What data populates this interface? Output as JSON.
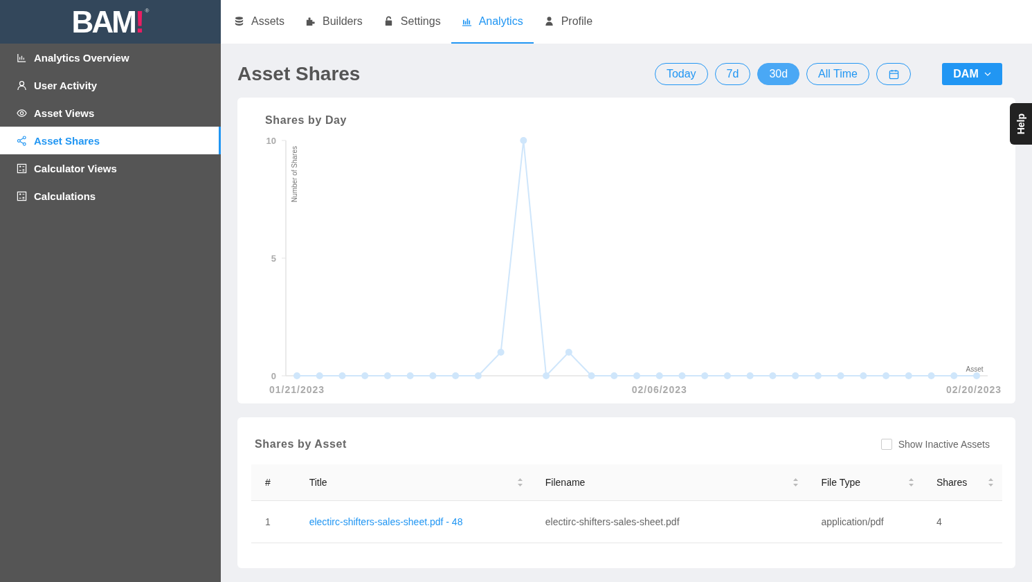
{
  "logo": {
    "text": "BAM",
    "mark": "!",
    "registered": "®"
  },
  "sidebar": {
    "items": [
      {
        "label": "Analytics Overview",
        "selected": false
      },
      {
        "label": "User Activity",
        "selected": false
      },
      {
        "label": "Asset Views",
        "selected": false
      },
      {
        "label": "Asset Shares",
        "selected": true
      },
      {
        "label": "Calculator Views",
        "selected": false
      },
      {
        "label": "Calculations",
        "selected": false
      }
    ]
  },
  "tabs": [
    {
      "label": "Assets",
      "selected": false
    },
    {
      "label": "Builders",
      "selected": false
    },
    {
      "label": "Settings",
      "selected": false
    },
    {
      "label": "Analytics",
      "selected": true
    },
    {
      "label": "Profile",
      "selected": false
    }
  ],
  "page_title": "Asset Shares",
  "ranges": [
    {
      "label": "Today",
      "kind": "text",
      "selected": false
    },
    {
      "label": "7d",
      "kind": "text",
      "selected": false
    },
    {
      "label": "30d",
      "kind": "text",
      "selected": true
    },
    {
      "label": "All Time",
      "kind": "text",
      "selected": false
    },
    {
      "kind": "calendar",
      "selected": false
    }
  ],
  "source_menu": {
    "label": "DAM"
  },
  "help_tab": "Help",
  "chart_card": {
    "title": "Shares by Day",
    "chart_data": {
      "type": "line",
      "ylabel": "Number of Shares",
      "categories": [
        "01/21/2023",
        null,
        null,
        null,
        null,
        null,
        null,
        null,
        null,
        null,
        null,
        null,
        null,
        null,
        null,
        null,
        "02/06/2023",
        null,
        null,
        null,
        null,
        null,
        null,
        null,
        null,
        null,
        null,
        null,
        null,
        null,
        "02/20/2023"
      ],
      "series": [
        {
          "name": "Asset",
          "color": "#cfe6fb",
          "marker": "circle",
          "values": [
            0,
            0,
            0,
            0,
            0,
            0,
            0,
            0,
            0,
            1,
            10,
            0,
            1,
            0,
            0,
            0,
            0,
            0,
            0,
            0,
            0,
            0,
            0,
            0,
            0,
            0,
            0,
            0,
            0,
            0,
            0
          ]
        }
      ],
      "ylim": [
        0,
        10
      ],
      "yticks": [
        0,
        5,
        10
      ]
    }
  },
  "table_card": {
    "title": "Shares by Asset",
    "show_inactive": {
      "label": "Show Inactive Assets",
      "checked": false
    },
    "columns": [
      {
        "label": "#",
        "sortable": false
      },
      {
        "label": "Title",
        "sortable": true
      },
      {
        "label": "Filename",
        "sortable": true
      },
      {
        "label": "File Type",
        "sortable": true
      },
      {
        "label": "Shares",
        "sortable": true
      }
    ],
    "rows": [
      {
        "index": "1",
        "title": "electirc-shifters-sales-sheet.pdf - 48",
        "filename": "electirc-shifters-sales-sheet.pdf",
        "file_type": "application/pdf",
        "shares": "4"
      }
    ]
  }
}
